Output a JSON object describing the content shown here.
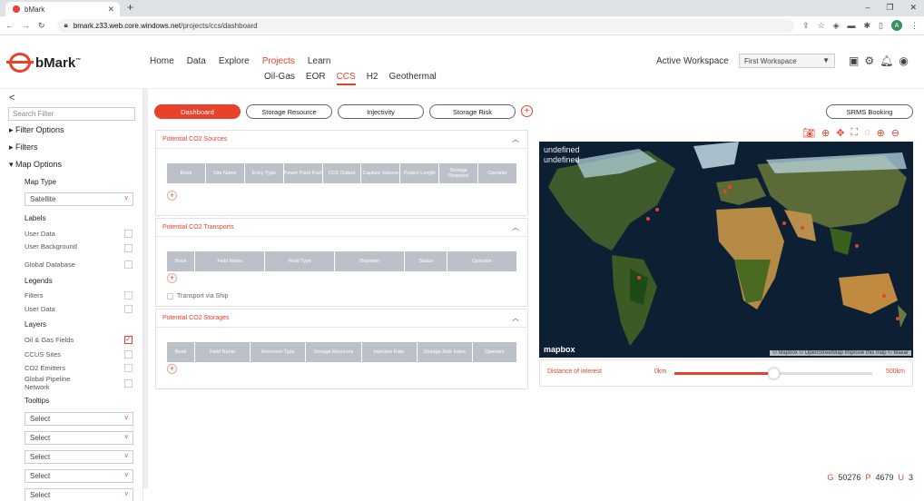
{
  "browser": {
    "tab_title": "bMark",
    "new_tab": "+",
    "url_host": "bmark.z33.web.core.windows.net",
    "url_path": "/projects/ccs/dashboard",
    "avatar": "A",
    "window_controls": [
      "–",
      "❐",
      "✕"
    ]
  },
  "app": {
    "logo_text": "bMark",
    "logo_tm": "™",
    "main_nav": [
      "Home",
      "Data",
      "Explore",
      "Projects",
      "Learn"
    ],
    "active_main": "Projects",
    "sub_nav": [
      "Oil-Gas",
      "EOR",
      "CCS",
      "H2",
      "Geothermal"
    ],
    "active_sub": "CCS",
    "workspace_label": "Active Workspace",
    "workspace_value": "First Workspace"
  },
  "sidebar": {
    "search_placeholder": "Search Filter",
    "sections": [
      "Filter Options",
      "Filters",
      "Map Options"
    ],
    "map_type_label": "Map Type",
    "map_type_value": "Satellite",
    "labels_heading": "Labels",
    "labels": [
      {
        "label": "User Data",
        "checked": false
      },
      {
        "label": "User Background",
        "checked": false
      },
      {
        "label": "Global Database",
        "checked": false
      }
    ],
    "legends_heading": "Legends",
    "legends": [
      {
        "label": "Filters",
        "checked": false
      },
      {
        "label": "User Data",
        "checked": false
      }
    ],
    "layers_heading": "Layers",
    "layers": [
      {
        "label": "Oil & Gas Fields",
        "checked": true
      },
      {
        "label": "CCUS Sites",
        "checked": false
      },
      {
        "label": "CO2 Emitters",
        "checked": false
      },
      {
        "label": "Global Pipeline Network",
        "checked": false
      }
    ],
    "tooltips_heading": "Tooltips",
    "tooltip_selects": [
      "Select",
      "Select",
      "Select",
      "Select",
      "Select"
    ]
  },
  "tabs": [
    "Dashboard",
    "Storage Resource",
    "Injectivity",
    "Storage Risk"
  ],
  "active_tab": "Dashboard",
  "srms_button": "SRMS Booking",
  "panels": {
    "sources": {
      "title": "Potential CO2 Sources",
      "columns": [
        "Book",
        "Site Name",
        "Entry Type",
        "Power Plant Fuel",
        "CO2 Output",
        "Capture Volume",
        "Project Length",
        "Storage Required",
        "Operator"
      ]
    },
    "transports": {
      "title": "Potential CO2 Transports",
      "columns": [
        "Book",
        "Field Name",
        "Fluid Type",
        "Diameter",
        "Status",
        "Operator"
      ],
      "ship_label": "Transport via Ship"
    },
    "storages": {
      "title": "Potential CO2 Storages",
      "columns": [
        "Book",
        "Field Name",
        "Reservoir Type",
        "Storage Resource",
        "Injection Rate",
        "Storage Risk Index",
        "Operator"
      ]
    }
  },
  "map": {
    "overlay_line1": "undefined",
    "overlay_line2": "undefined",
    "logo": "mapbox",
    "attribution": "© Mapbox © OpenStreetMap Improve this map © Maxar"
  },
  "distance": {
    "label": "Distance of interest",
    "min_label": "0km",
    "max_label": "500km",
    "level_fraction": 0.5
  },
  "stats": [
    {
      "key": "G",
      "value": "50276"
    },
    {
      "key": "P",
      "value": "4679"
    },
    {
      "key": "U",
      "value": "3"
    }
  ],
  "colors": {
    "accent": "#e8412c",
    "table_header": "#bcc0c8"
  }
}
